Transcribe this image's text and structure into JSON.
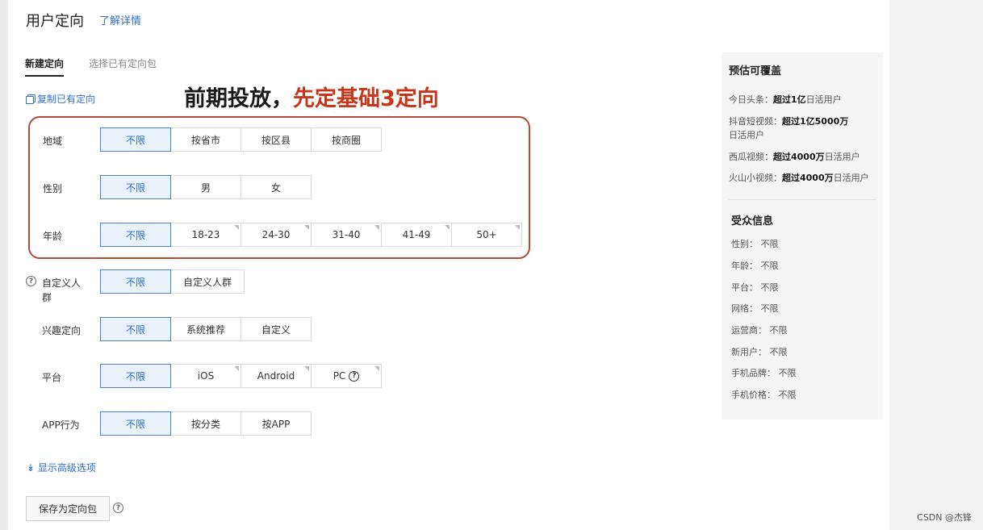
{
  "header": {
    "title": "用户定向",
    "learn_more": "了解详情"
  },
  "tabs": [
    {
      "label": "新建定向"
    },
    {
      "label": "选择已有定向包"
    }
  ],
  "copy_link": "复制已有定向",
  "annotation": {
    "black": "前期投放，",
    "red": "先定基础3定向"
  },
  "rows": {
    "region": {
      "label": "地域",
      "options": [
        "不限",
        "按省市",
        "按区县",
        "按商圈"
      ]
    },
    "gender": {
      "label": "性别",
      "options": [
        "不限",
        "男",
        "女"
      ]
    },
    "age": {
      "label": "年龄",
      "options": [
        "不限",
        "18-23",
        "24-30",
        "31-40",
        "41-49",
        "50+"
      ]
    },
    "custom_crowd": {
      "label_line1": "自定义人",
      "label_line2": "群",
      "options": [
        "不限",
        "自定义人群"
      ]
    },
    "interest": {
      "label": "兴趣定向",
      "options": [
        "不限",
        "系统推荐",
        "自定义"
      ]
    },
    "platform": {
      "label": "平台",
      "options": [
        "不限",
        "iOS",
        "Android",
        "PC"
      ]
    },
    "app_behavior": {
      "label": "APP行为",
      "options": [
        "不限",
        "按分类",
        "按APP"
      ]
    }
  },
  "advanced_link": "显示高级选项",
  "save_button": "保存为定向包",
  "coverage": {
    "title": "预估可覆盖",
    "toutiao": {
      "name": "今日头条：",
      "value": "超过1亿",
      "unit": "日活用户"
    },
    "douyin": {
      "name": "抖音短视频：",
      "value": "超过1亿5000万",
      "unit": "日活用户"
    },
    "xigua": {
      "name": "西瓜视频：",
      "value": "超过4000万",
      "unit": "日活用户"
    },
    "huoshan": {
      "name": "火山小视频：",
      "value": "超过4000万",
      "unit": "日活用户"
    }
  },
  "audience": {
    "title": "受众信息",
    "items": [
      "性别：  不限",
      "年龄：  不限",
      "平台：  不限",
      "网络：  不限",
      "运营商：  不限",
      "新用户：  不限",
      "手机品牌：  不限",
      "手机价格：  不限"
    ]
  },
  "watermark": "CSDN @杰锋",
  "colors": {
    "accent": "#2f6fd6",
    "annotation_red": "#c8361a",
    "highlight_border": "#b34a3a",
    "selected_bg": "#e9f1fb"
  }
}
